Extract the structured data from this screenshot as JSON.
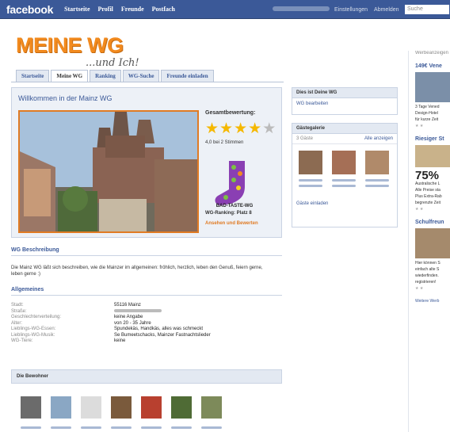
{
  "fb": {
    "logo": "facebook",
    "nav": [
      "Startseite",
      "Profil",
      "Freunde",
      "Postfach"
    ],
    "settings": "Einstellungen",
    "logout": "Abmelden",
    "search_placeholder": "Suche"
  },
  "app": {
    "logo_main": "MEINE WG",
    "logo_sub": "...und Ich!",
    "tabs": [
      "Startseite",
      "Meine WG",
      "Ranking",
      "WG-Suche",
      "Freunde einladen"
    ],
    "active_tab": "Meine WG"
  },
  "welcome": {
    "title": "Willkommen in der Mainz WG",
    "rating_title": "Gesamtbewertung:",
    "rating_value": 4,
    "rating_max": 5,
    "rating_text": "4,0 bei 2 Stimmen",
    "badge_text": "BAD-TASTE-WG",
    "ranking": "WG-Ranking: Platz 8",
    "rate_link": "Ansehen und Bewerten"
  },
  "description": {
    "heading": "WG Beschreibung",
    "text": "Die Mainz WG läßt sich beschreiben, wie die Mainzer im allgemeinen: fröhlich, herzlich, leben den Genuß, feiern gerne, leben gerne :)"
  },
  "general": {
    "heading": "Allgemeines",
    "rows": [
      {
        "k": "Stadt:",
        "v": "55116 Mainz"
      },
      {
        "k": "Straße:",
        "v": ""
      },
      {
        "k": "Geschlechterverteilung:",
        "v": "keine Angabe"
      },
      {
        "k": "Alter:",
        "v": "von 20 - 35 Jahre"
      },
      {
        "k": "Lieblings-WG-Essen:",
        "v": "Spundekäs, Handkäs, alles was schmeckt"
      },
      {
        "k": "Lieblings-WG-Musik:",
        "v": "Se Bumeetschacks, Mainzer Fastnachtslieder"
      },
      {
        "k": "WG-Tiere:",
        "v": "keine"
      }
    ]
  },
  "residents": {
    "heading": "Die Bewohner",
    "count": 7
  },
  "sidebar": {
    "mywg_title": "Dies ist Deine WG",
    "mywg_link": "WG bearbeiten",
    "gallery_title": "Gästegalerie",
    "gallery_count": "3 Gäste",
    "gallery_all": "Alle anzeigen",
    "invite": "Gäste einladen"
  },
  "ads": {
    "label": "Werbeanzeigen",
    "items": [
      {
        "title": "149€ Vene",
        "text": [
          "3 Tage Vened",
          "Design-Hotel",
          "für kurze Zeit"
        ]
      },
      {
        "title": "Riesiger St",
        "big": "75%",
        "text": [
          "Australische L",
          "Alle Preise sta",
          "Plus Extra-Rab",
          "begrenzte Zeit"
        ]
      },
      {
        "title": "Schulfreun",
        "text": [
          "Hier können S",
          "einfach alte S",
          "wiederfinden.",
          "registrieren!"
        ]
      }
    ],
    "more": "Weitere Werb"
  }
}
